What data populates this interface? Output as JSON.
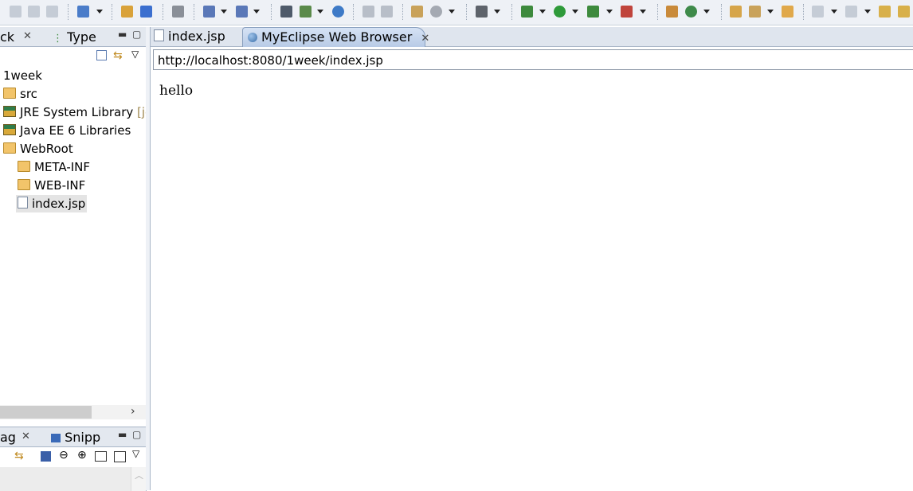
{
  "toolbar": {
    "icons": [
      "save-icon",
      "save-all-icon",
      "print-icon",
      "new-wizard-icon",
      "package-icon",
      "cube-icon",
      "jar-icon",
      "deploy-icon",
      "search-icon",
      "server-icon",
      "browser-icon",
      "folder-open-icon",
      "import-icon",
      "clipboard-icon",
      "web-icon",
      "camera-icon",
      "debug-icon",
      "run-icon",
      "run-config-icon",
      "external-tools-icon",
      "plugin-icon",
      "refresh-icon",
      "open-folder-icon",
      "rocket-icon",
      "open-icon",
      "next-annotation-icon",
      "prev-annotation-icon",
      "back-icon",
      "forward-icon"
    ]
  },
  "left_top": {
    "tab1_label": "ck",
    "tab2_label": "Type",
    "tree": [
      {
        "label": "1week",
        "icon": "project-icon"
      },
      {
        "label": "src",
        "icon": "package-folder-icon"
      },
      {
        "label": "JRE System Library",
        "suffix": "[jd",
        "icon": "library-icon"
      },
      {
        "label": "Java EE 6 Libraries",
        "icon": "library-icon"
      },
      {
        "label": "WebRoot",
        "icon": "folder-icon"
      },
      {
        "label": "META-INF",
        "icon": "folder-icon"
      },
      {
        "label": "WEB-INF",
        "icon": "folder-icon"
      },
      {
        "label": "index.jsp",
        "icon": "jsp-file-icon"
      }
    ]
  },
  "left_bottom": {
    "tab1_label": "ag",
    "tab2_label": "Snipp"
  },
  "editor": {
    "tab1_label": "index.jsp",
    "tab2_label": "MyEclipse Web Browser",
    "url": "http://localhost:8080/1week/index.jsp",
    "content": "hello"
  },
  "colors": {
    "toolbar_bg": "#eef1f6",
    "tab_active": "#b8cbe6",
    "selection": "#e4e4e4",
    "decorator": "#a08850"
  }
}
